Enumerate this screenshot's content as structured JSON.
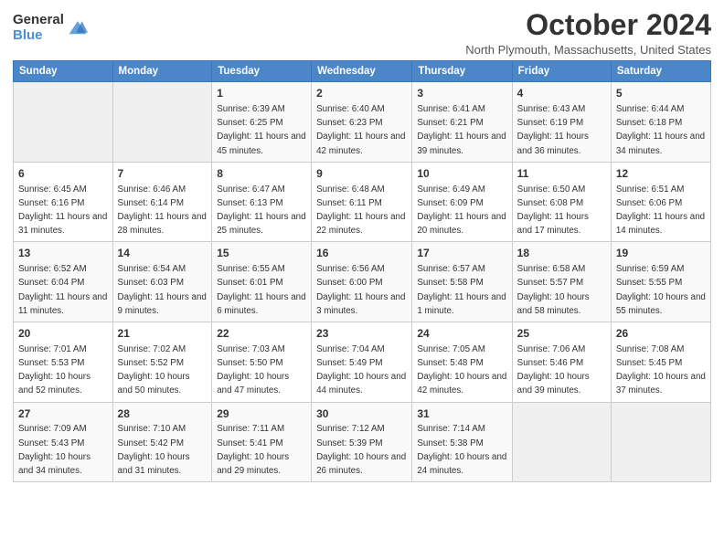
{
  "header": {
    "logo_general": "General",
    "logo_blue": "Blue",
    "title": "October 2024",
    "location": "North Plymouth, Massachusetts, United States"
  },
  "columns": [
    "Sunday",
    "Monday",
    "Tuesday",
    "Wednesday",
    "Thursday",
    "Friday",
    "Saturday"
  ],
  "weeks": [
    [
      {
        "day": "",
        "detail": ""
      },
      {
        "day": "",
        "detail": ""
      },
      {
        "day": "1",
        "detail": "Sunrise: 6:39 AM\nSunset: 6:25 PM\nDaylight: 11 hours and 45 minutes."
      },
      {
        "day": "2",
        "detail": "Sunrise: 6:40 AM\nSunset: 6:23 PM\nDaylight: 11 hours and 42 minutes."
      },
      {
        "day": "3",
        "detail": "Sunrise: 6:41 AM\nSunset: 6:21 PM\nDaylight: 11 hours and 39 minutes."
      },
      {
        "day": "4",
        "detail": "Sunrise: 6:43 AM\nSunset: 6:19 PM\nDaylight: 11 hours and 36 minutes."
      },
      {
        "day": "5",
        "detail": "Sunrise: 6:44 AM\nSunset: 6:18 PM\nDaylight: 11 hours and 34 minutes."
      }
    ],
    [
      {
        "day": "6",
        "detail": "Sunrise: 6:45 AM\nSunset: 6:16 PM\nDaylight: 11 hours and 31 minutes."
      },
      {
        "day": "7",
        "detail": "Sunrise: 6:46 AM\nSunset: 6:14 PM\nDaylight: 11 hours and 28 minutes."
      },
      {
        "day": "8",
        "detail": "Sunrise: 6:47 AM\nSunset: 6:13 PM\nDaylight: 11 hours and 25 minutes."
      },
      {
        "day": "9",
        "detail": "Sunrise: 6:48 AM\nSunset: 6:11 PM\nDaylight: 11 hours and 22 minutes."
      },
      {
        "day": "10",
        "detail": "Sunrise: 6:49 AM\nSunset: 6:09 PM\nDaylight: 11 hours and 20 minutes."
      },
      {
        "day": "11",
        "detail": "Sunrise: 6:50 AM\nSunset: 6:08 PM\nDaylight: 11 hours and 17 minutes."
      },
      {
        "day": "12",
        "detail": "Sunrise: 6:51 AM\nSunset: 6:06 PM\nDaylight: 11 hours and 14 minutes."
      }
    ],
    [
      {
        "day": "13",
        "detail": "Sunrise: 6:52 AM\nSunset: 6:04 PM\nDaylight: 11 hours and 11 minutes."
      },
      {
        "day": "14",
        "detail": "Sunrise: 6:54 AM\nSunset: 6:03 PM\nDaylight: 11 hours and 9 minutes."
      },
      {
        "day": "15",
        "detail": "Sunrise: 6:55 AM\nSunset: 6:01 PM\nDaylight: 11 hours and 6 minutes."
      },
      {
        "day": "16",
        "detail": "Sunrise: 6:56 AM\nSunset: 6:00 PM\nDaylight: 11 hours and 3 minutes."
      },
      {
        "day": "17",
        "detail": "Sunrise: 6:57 AM\nSunset: 5:58 PM\nDaylight: 11 hours and 1 minute."
      },
      {
        "day": "18",
        "detail": "Sunrise: 6:58 AM\nSunset: 5:57 PM\nDaylight: 10 hours and 58 minutes."
      },
      {
        "day": "19",
        "detail": "Sunrise: 6:59 AM\nSunset: 5:55 PM\nDaylight: 10 hours and 55 minutes."
      }
    ],
    [
      {
        "day": "20",
        "detail": "Sunrise: 7:01 AM\nSunset: 5:53 PM\nDaylight: 10 hours and 52 minutes."
      },
      {
        "day": "21",
        "detail": "Sunrise: 7:02 AM\nSunset: 5:52 PM\nDaylight: 10 hours and 50 minutes."
      },
      {
        "day": "22",
        "detail": "Sunrise: 7:03 AM\nSunset: 5:50 PM\nDaylight: 10 hours and 47 minutes."
      },
      {
        "day": "23",
        "detail": "Sunrise: 7:04 AM\nSunset: 5:49 PM\nDaylight: 10 hours and 44 minutes."
      },
      {
        "day": "24",
        "detail": "Sunrise: 7:05 AM\nSunset: 5:48 PM\nDaylight: 10 hours and 42 minutes."
      },
      {
        "day": "25",
        "detail": "Sunrise: 7:06 AM\nSunset: 5:46 PM\nDaylight: 10 hours and 39 minutes."
      },
      {
        "day": "26",
        "detail": "Sunrise: 7:08 AM\nSunset: 5:45 PM\nDaylight: 10 hours and 37 minutes."
      }
    ],
    [
      {
        "day": "27",
        "detail": "Sunrise: 7:09 AM\nSunset: 5:43 PM\nDaylight: 10 hours and 34 minutes."
      },
      {
        "day": "28",
        "detail": "Sunrise: 7:10 AM\nSunset: 5:42 PM\nDaylight: 10 hours and 31 minutes."
      },
      {
        "day": "29",
        "detail": "Sunrise: 7:11 AM\nSunset: 5:41 PM\nDaylight: 10 hours and 29 minutes."
      },
      {
        "day": "30",
        "detail": "Sunrise: 7:12 AM\nSunset: 5:39 PM\nDaylight: 10 hours and 26 minutes."
      },
      {
        "day": "31",
        "detail": "Sunrise: 7:14 AM\nSunset: 5:38 PM\nDaylight: 10 hours and 24 minutes."
      },
      {
        "day": "",
        "detail": ""
      },
      {
        "day": "",
        "detail": ""
      }
    ]
  ]
}
